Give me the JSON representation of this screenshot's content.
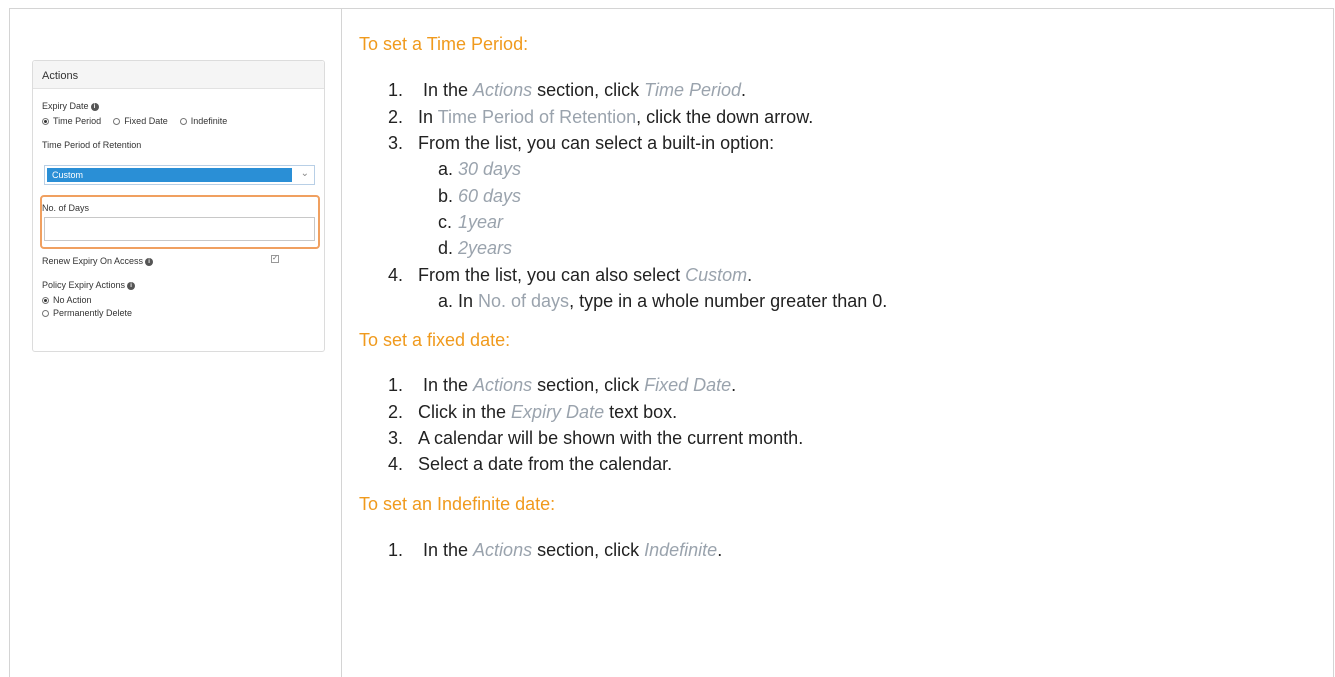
{
  "panel": {
    "title": "Actions",
    "expiry_label": "Expiry Date",
    "expiry_options": [
      "Time Period",
      "Fixed Date",
      "Indefinite"
    ],
    "expiry_selected": "Time Period",
    "retention_label": "Time Period of Retention",
    "retention_value": "Custom",
    "days_label": "No. of Days",
    "days_value": "",
    "renew_label": "Renew Expiry On Access",
    "renew_checked": true,
    "policy_label": "Policy Expiry Actions",
    "policy_options": [
      "No Action",
      "Permanently Delete"
    ],
    "policy_selected": "No Action"
  },
  "sections": [
    {
      "heading": "To set a Time Period:",
      "steps": [
        {
          "num": "1.",
          "parts": [
            " In the ",
            "Actions",
            " section, click ",
            "Time Period",
            "."
          ]
        },
        {
          "num": "2.",
          "parts": [
            "In ",
            "Time Period of Retention",
            ", click the down arrow."
          ]
        },
        {
          "num": "3.",
          "parts": [
            "From the list, you can select a built-in option:"
          ]
        },
        {
          "num": "a.",
          "parts": [
            "30 days"
          ]
        },
        {
          "num": "b.",
          "parts": [
            "60 days"
          ]
        },
        {
          "num": "c.",
          "parts": [
            "1year"
          ]
        },
        {
          "num": "d.",
          "parts": [
            "2years"
          ]
        },
        {
          "num": "4.",
          "parts": [
            "From the list, you can also select ",
            "Custom",
            "."
          ]
        },
        {
          "num": "a.",
          "parts": [
            "In ",
            "No. of days",
            ", type in a whole number greater than 0."
          ]
        }
      ]
    },
    {
      "heading": "To set a fixed date:",
      "steps": [
        {
          "num": "1.",
          "parts": [
            " In the ",
            "Actions",
            " section, click ",
            "Fixed Date",
            "."
          ]
        },
        {
          "num": "2.",
          "parts": [
            "Click in the ",
            "Expiry Date",
            " text box."
          ]
        },
        {
          "num": "3.",
          "parts": [
            "A calendar will be shown with the current month."
          ]
        },
        {
          "num": "4.",
          "parts": [
            "Select a date from the calendar."
          ]
        }
      ]
    },
    {
      "heading": "To set an Indefinite date:",
      "steps": [
        {
          "num": "1.",
          "parts": [
            " In the ",
            "Actions",
            "  section, click ",
            "Indefinite",
            "."
          ]
        }
      ]
    }
  ],
  "colors": {
    "heading": "#f09a1d",
    "emphasis": "#9aa3ad",
    "select_highlight": "#2a8fd6",
    "callout": "#f0a060"
  }
}
